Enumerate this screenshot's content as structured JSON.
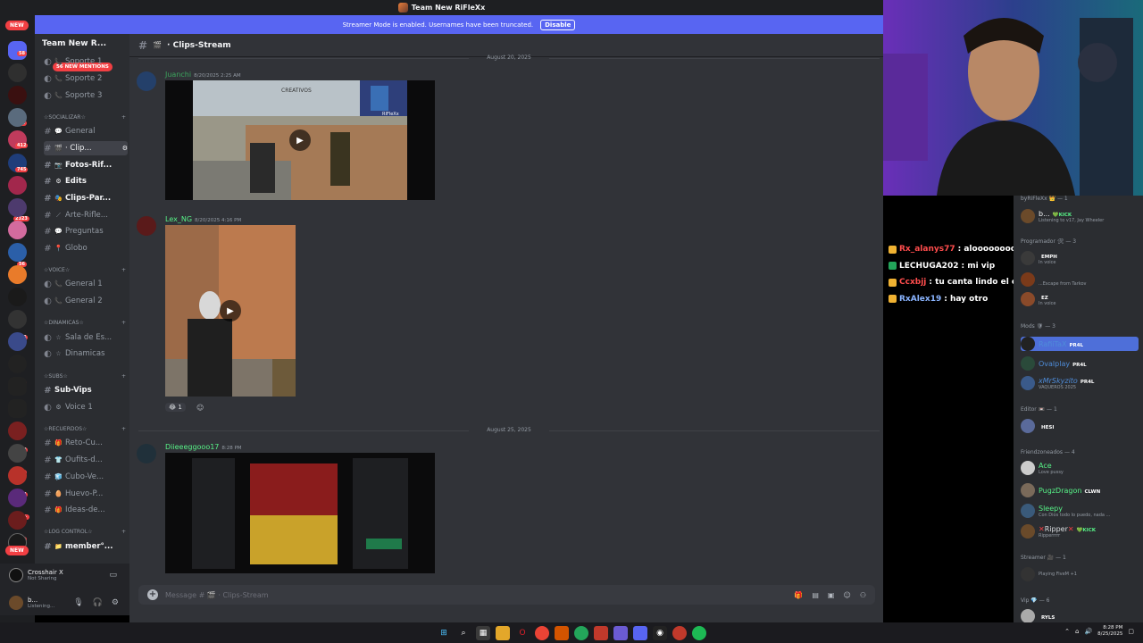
{
  "window": {
    "title": "Team New RiFleXx"
  },
  "streamer_banner": {
    "text": "Streamer Mode is enabled. Usernames have been truncated.",
    "button": "Disable"
  },
  "rail": {
    "new_top": "NEW",
    "new_bottom": "NEW",
    "badges": [
      "58",
      "11",
      "412",
      "745",
      "2323",
      "56",
      "116",
      "45",
      "689",
      "32",
      "478",
      "1K+",
      "20"
    ]
  },
  "server": {
    "name": "Team New R...",
    "mentions": "56 NEW MENTIONS",
    "categories": [
      "☆SOCIALIZAR☆",
      "☆VOICE☆",
      "☆DINAMICAS☆",
      "☆SUBS☆",
      "☆RECUERDOS☆",
      "☆LOG CONTROL☆"
    ],
    "channels": [
      {
        "label": "Soporte 1",
        "emoji": "📞"
      },
      {
        "label": "Soporte 2",
        "emoji": "📞"
      },
      {
        "label": "Soporte 3",
        "emoji": "📞"
      },
      {
        "label": "General",
        "emoji": "💬"
      },
      {
        "label": "· Clip...",
        "emoji": "🎬"
      },
      {
        "label": "Fotos-Rif...",
        "emoji": "📷"
      },
      {
        "label": "Edits",
        "emoji": "⚙"
      },
      {
        "label": "Clips-Par...",
        "emoji": "🎭"
      },
      {
        "label": "Arte-Rifle...",
        "emoji": "⟋"
      },
      {
        "label": "Preguntas",
        "emoji": "💬"
      },
      {
        "label": "Globo",
        "emoji": "📍"
      },
      {
        "label": "General 1",
        "emoji": "📞"
      },
      {
        "label": "General 2",
        "emoji": "📞"
      },
      {
        "label": "Sala de Es...",
        "emoji": "☆"
      },
      {
        "label": "Dinamicas",
        "emoji": "☆"
      },
      {
        "label": "Sub-Vips",
        "emoji": ""
      },
      {
        "label": "Voice 1",
        "emoji": "⚙"
      },
      {
        "label": "Reto-Cu...",
        "emoji": "🎁"
      },
      {
        "label": "Oufits-d...",
        "emoji": "👕"
      },
      {
        "label": "Cubo-Ve...",
        "emoji": "🧊"
      },
      {
        "label": "Huevo-P...",
        "emoji": "🥚"
      },
      {
        "label": "Ideas-de...",
        "emoji": "🎁"
      },
      {
        "label": "member°...",
        "emoji": "📁"
      }
    ]
  },
  "user": {
    "app_name": "Crosshair X",
    "app_status": "Not Sharing",
    "name": "b...",
    "status": "Listening..."
  },
  "channel": {
    "name": "· Clips-Stream",
    "composer_placeholder": "Message # 🎬 · Clips-Stream"
  },
  "messages": [
    {
      "author": "Juanchi",
      "time": "8/20/2025 2:25 AM",
      "color": "#3ba55d"
    },
    {
      "author": "Lex_NG",
      "time": "8/20/2025 4:16 PM",
      "color": "#57f287",
      "reaction_count": "1"
    },
    {
      "author": "Diieeeggooo17",
      "time": "8:28 PM",
      "color": "#57f287"
    }
  ],
  "dates": [
    "August 20, 2025",
    "August 25, 2025"
  ],
  "video1": {
    "watermark": "RIFleXx",
    "brand": "CREATIVOS"
  },
  "stream_chat": [
    {
      "user": "Rx_alanys77",
      "text": ": aloooooooooo",
      "color": "#ff4d4d",
      "icon": "#f0b232"
    },
    {
      "user": "LECHUGA202",
      "text": ": mi vip",
      "color": "#ffffff",
      "icon": "#23a55a"
    },
    {
      "user": "Ccxbjj",
      "text": ": tu canta lindo el chat esta un poco loco",
      "color": "#ff4d4d",
      "icon": "#f0b232"
    },
    {
      "user": "RxAlex19",
      "text": ": hay otro",
      "color": "#8ab4ff",
      "icon": "#f0b232"
    }
  ],
  "members": {
    "groups": [
      {
        "title": "byRiFleXx 👑 — 1"
      },
      {
        "title": "Programador 🛠 — 3"
      },
      {
        "title": "Mods 🛡 — 3"
      },
      {
        "title": "Editor 📼 — 1"
      },
      {
        "title": "Friendzoneados — 4"
      },
      {
        "title": "Streamer 🎥 — 1"
      },
      {
        "title": "Vip 💎 — 6"
      }
    ],
    "list": [
      {
        "name": "b...",
        "tag": "💚KICK",
        "sub": "Listening to v17, Jay Wheeler",
        "color": "#f2f3f5"
      },
      {
        "name": "",
        "tag": "EMPH",
        "sub": "In voice",
        "color": "#f2f3f5"
      },
      {
        "name": "",
        "tag": "",
        "sub": "...Escape from Tarkov",
        "color": "#f2f3f5"
      },
      {
        "name": "",
        "tag": "EZ",
        "sub": "In voice",
        "color": "#f2f3f5"
      },
      {
        "name": "RafiiTaX",
        "tag": "PR4L",
        "sub": "",
        "color": "#4e8cd9"
      },
      {
        "name": "Ovalplay",
        "tag": "PR4L",
        "sub": "",
        "color": "#4e8cd9"
      },
      {
        "name": "xMrSkyzito",
        "tag": "PR4L",
        "sub": "VAQUEROS 2025",
        "color": "#4e8cd9"
      },
      {
        "name": "",
        "tag": "HESI",
        "sub": "",
        "color": "#f2f3f5"
      },
      {
        "name": "Ace",
        "tag": "",
        "sub": "Love pussy",
        "color": "#57f287"
      },
      {
        "name": "PugzDragon",
        "tag": "CLWN",
        "sub": "",
        "color": "#57f287"
      },
      {
        "name": "Sleepy",
        "tag": "",
        "sub": "Con Dios todo lo puedo, nada ...",
        "color": "#57f287"
      },
      {
        "name": "Ripper",
        "tag": "💚KICK",
        "sub": "Ripperrrrr",
        "color": "#f2f3f5"
      },
      {
        "name": "",
        "tag": "",
        "sub": "Playing FiveM +1",
        "color": "#9b59ff"
      },
      {
        "name": "",
        "tag": "RYLS",
        "sub": "",
        "color": "#ff4d9d"
      }
    ]
  },
  "taskbar": {
    "time": "8:28 PM",
    "date": "8/25/2025"
  }
}
